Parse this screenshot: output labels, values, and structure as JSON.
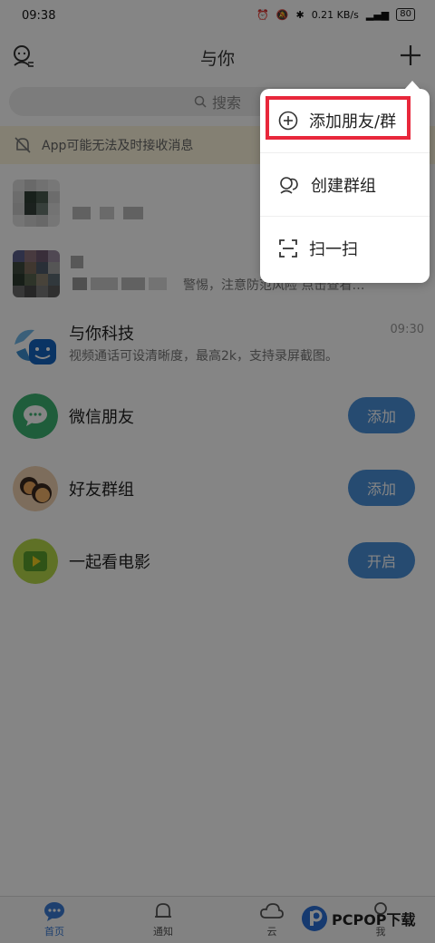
{
  "status_bar": {
    "time": "09:38",
    "net_speed": "0.21 KB/s",
    "battery": "80"
  },
  "header": {
    "title": "与你"
  },
  "search": {
    "placeholder": "搜索"
  },
  "notice": {
    "text": "App可能无法及时接收消息"
  },
  "chats": [
    {
      "name": "",
      "preview": "",
      "time": ""
    },
    {
      "name": "",
      "preview": "警惕，注意防范风险 点击查看…",
      "time": ""
    },
    {
      "name": "与你科技",
      "preview": "视频通话可设清晰度，最高2k，支持录屏截图。",
      "time": "09:30"
    }
  ],
  "actions": [
    {
      "label": "微信朋友",
      "button": "添加",
      "color": "#3cb371"
    },
    {
      "label": "好友群组",
      "button": "添加",
      "color": "#e8a45a"
    },
    {
      "label": "一起看电影",
      "button": "开启",
      "color": "#a5c93a"
    }
  ],
  "tabs": [
    {
      "label": "首页",
      "icon": "chat-bubble-icon"
    },
    {
      "label": "通知",
      "icon": "bell-icon"
    },
    {
      "label": "云",
      "icon": "cloud-icon"
    },
    {
      "label": "我",
      "icon": "person-icon"
    }
  ],
  "menu": {
    "items": [
      {
        "label": "添加朋友/群",
        "icon": "add-circle-icon"
      },
      {
        "label": "创建群组",
        "icon": "group-icon"
      },
      {
        "label": "扫一扫",
        "icon": "scan-icon"
      }
    ]
  },
  "watermark": {
    "text": "PCPOP下载"
  },
  "colors": {
    "accent": "#3a7bd5",
    "highlight_border": "#e8273b",
    "button": "#4a90d9"
  }
}
